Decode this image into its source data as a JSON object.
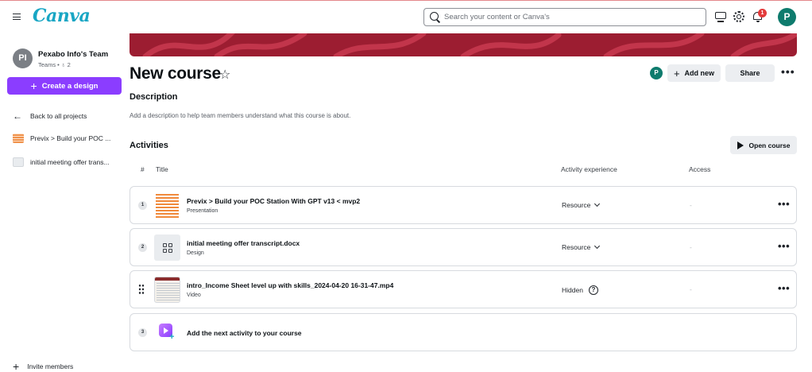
{
  "app": {
    "logo": "Canva"
  },
  "search": {
    "placeholder": "Search your content or Canva's"
  },
  "notifications": {
    "count": "1"
  },
  "user": {
    "initial": "P"
  },
  "sidebar": {
    "team_initials": "PI",
    "team_name": "Pexabo Info's Team",
    "team_sub": "Teams • ♁ 2",
    "create_label": "Create a design",
    "back_label": "Back to all projects",
    "items": [
      {
        "label": "Previx > Build your POC ..."
      },
      {
        "label": "initial meeting offer trans..."
      }
    ],
    "invite_label": "Invite members"
  },
  "course": {
    "title": "New course",
    "collaborator_initial": "P",
    "add_new_label": "Add new",
    "share_label": "Share",
    "description_heading": "Description",
    "description_placeholder": "Add a description to help team members understand what this course is about.",
    "activities_heading": "Activities",
    "open_course_label": "Open course"
  },
  "table": {
    "columns": {
      "number": "#",
      "title": "Title",
      "experience": "Activity experience",
      "access": "Access"
    },
    "rows": [
      {
        "number": "1",
        "title": "Previx > Build your POC Station With GPT v13 < mvp2",
        "type": "Presentation",
        "experience": "Resource",
        "access": "-"
      },
      {
        "number": "2",
        "title": "initial meeting offer transcript.docx",
        "type": "Design",
        "experience": "Resource",
        "access": "-"
      },
      {
        "number": "",
        "title": "intro_Income Sheet level up with skills_2024-04-20 16-31-47.mp4",
        "type": "Video",
        "experience": "Hidden",
        "access": "-"
      },
      {
        "number": "3",
        "title": "Add the next activity to your course"
      }
    ]
  },
  "colors": {
    "brand": "#19a6c4",
    "accent": "#8b3dff",
    "banner": "#9c1d31",
    "avatar": "#0e7b6d",
    "badge": "#e33b3b"
  },
  "icons": [
    "hamburger-icon",
    "search-icon",
    "monitor-icon",
    "gear-icon",
    "bell-icon",
    "star-icon",
    "plus-icon",
    "play-icon",
    "more-icon",
    "chevron-down-icon",
    "help-icon",
    "drag-handle-icon"
  ]
}
